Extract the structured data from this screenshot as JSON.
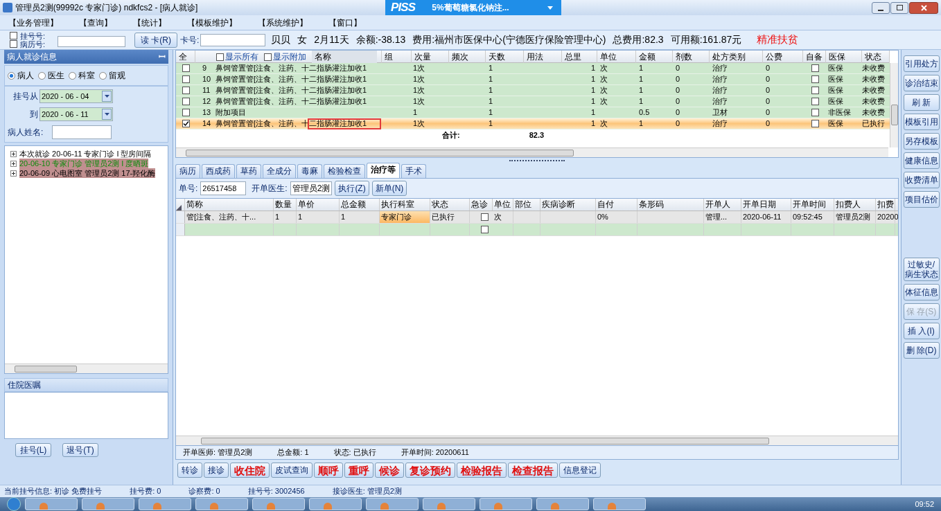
{
  "window": {
    "title": "管理员2测(99992c 专家门诊) ndkfcs2 - [病人就诊]",
    "logo": "PISS",
    "drug_dropdown": "5%葡萄糖氯化钠注..."
  },
  "menu": [
    "【业务管理】",
    "【查询】",
    "【统计】",
    "【模板维护】",
    "【系统维护】",
    "【窗口】"
  ],
  "patient_bar": {
    "id_options": [
      {
        "label": "挂号号:",
        "checked": false
      },
      {
        "label": "病历号:",
        "checked": false
      }
    ],
    "read_card": "读 卡(R)",
    "card_label": "卡号:",
    "info": [
      "贝贝",
      "女",
      "2月11天",
      "余额:-38.13",
      "费用:福州市医保中心(宁德医疗保险管理中心)",
      "总费用:82.3",
      "可用额:161.87元"
    ],
    "tag": "精准扶贫"
  },
  "left_panel": {
    "title": "病人就诊信息",
    "pin": "ꟷ",
    "radios": [
      {
        "label": "病人",
        "selected": true
      },
      {
        "label": "医生",
        "selected": false
      },
      {
        "label": "科室",
        "selected": false
      },
      {
        "label": "留观",
        "selected": false
      }
    ],
    "from_label": "挂号从",
    "from_date": "2020 - 06 - 04",
    "to_label": "到",
    "to_date": "2020 - 06 - 11",
    "name_label": "病人姓名:",
    "visits": [
      {
        "text": "本次就诊 20-06-11 专家门诊 I 型房间隔",
        "kind": "current"
      },
      {
        "text": "20-06-10 专家门诊 管理员2测 I 度晒斑",
        "kind": "flagged"
      },
      {
        "text": "20-06-09 心电图室 管理员2测 17-羟化酶",
        "kind": "past"
      }
    ],
    "orders_title": "住院医嘱",
    "buttons": [
      "挂号(L)",
      "退号(T)"
    ]
  },
  "prescription": {
    "toggles": [
      {
        "label": "显示所有",
        "checked": false
      },
      {
        "label": "显示附加",
        "checked": false
      }
    ],
    "columns": [
      "全",
      "名称",
      "组",
      "次量",
      "频次",
      "天数",
      "用法",
      "总里",
      "单位",
      "金额",
      "剂数",
      "处方类别",
      "公费",
      "自备",
      "医保",
      "状态"
    ],
    "rows": [
      {
        "checked": false,
        "no": "9",
        "name": "鼻饲管置管[注食、注药、十二指肠灌注加收1",
        "dose": "1次",
        "days": "1",
        "total": "1",
        "unit": "次",
        "amount": "1",
        "count": "0",
        "category": "治疗",
        "public": "0",
        "own": false,
        "insurance": "医保",
        "status": "未收费",
        "selected": false,
        "marked": false
      },
      {
        "checked": false,
        "no": "10",
        "name": "鼻饲管置管[注食、注药、十二指肠灌注加收1",
        "dose": "1次",
        "days": "1",
        "total": "1",
        "unit": "次",
        "amount": "1",
        "count": "0",
        "category": "治疗",
        "public": "0",
        "own": false,
        "insurance": "医保",
        "status": "未收费",
        "selected": false,
        "marked": false
      },
      {
        "checked": false,
        "no": "11",
        "name": "鼻饲管置管[注食、注药、十二指肠灌注加收1",
        "dose": "1次",
        "days": "1",
        "total": "1",
        "unit": "次",
        "amount": "1",
        "count": "0",
        "category": "治疗",
        "public": "0",
        "own": false,
        "insurance": "医保",
        "status": "未收费",
        "selected": false,
        "marked": false
      },
      {
        "checked": false,
        "no": "12",
        "name": "鼻饲管置管[注食、注药、十二指肠灌注加收1",
        "dose": "1次",
        "days": "1",
        "total": "1",
        "unit": "次",
        "amount": "1",
        "count": "0",
        "category": "治疗",
        "public": "0",
        "own": false,
        "insurance": "医保",
        "status": "未收费",
        "selected": false,
        "marked": false
      },
      {
        "checked": false,
        "no": "13",
        "name": "附加项目",
        "dose": "1",
        "days": "1",
        "total": "1",
        "unit": "",
        "amount": "0.5",
        "count": "0",
        "category": "卫材",
        "public": "0",
        "own": false,
        "insurance": "非医保",
        "status": "未收费",
        "selected": false,
        "marked": false
      },
      {
        "checked": true,
        "no": "14",
        "name": "鼻饲管置管[注食、注药、十二指肠灌注加收1",
        "dose": "1次",
        "days": "1",
        "total": "1",
        "unit": "次",
        "amount": "1",
        "count": "0",
        "category": "治疗",
        "public": "0",
        "own": false,
        "insurance": "医保",
        "status": "已执行",
        "selected": true,
        "marked": true
      }
    ],
    "total_label": "合计:",
    "total_value": "82.3"
  },
  "tabs": [
    {
      "label": "病历",
      "selected": false
    },
    {
      "label": "西成药",
      "selected": false
    },
    {
      "label": "草药",
      "selected": false
    },
    {
      "label": "全成分",
      "selected": false
    },
    {
      "label": "毒麻",
      "selected": false
    },
    {
      "label": "检验检查",
      "selected": false
    },
    {
      "label": "治疗等",
      "selected": true
    },
    {
      "label": "手术",
      "selected": false
    }
  ],
  "order_form": {
    "no_label": "单号:",
    "no": "26517458",
    "doctor_label": "开单医生:",
    "doctor": "管理员2测",
    "buttons": [
      "执行(Z)",
      "新单(N)"
    ]
  },
  "order_table": {
    "columns": [
      "简称",
      "数量",
      "单价",
      "总金额",
      "执行科室",
      "状态",
      "急诊",
      "单位",
      "部位",
      "疾病诊断",
      "自付",
      "条形码",
      "开单人",
      "开单日期",
      "开单时间",
      "扣费人",
      "扣费"
    ],
    "rows": [
      {
        "cells": [
          "管[注食、注药、十...",
          "1",
          "1",
          "1",
          "专家门诊",
          "已执行",
          "",
          "次",
          "",
          "",
          "0%",
          "",
          "管理...",
          "2020-06-11",
          "09:52:45",
          "管理员2测",
          "20200"
        ],
        "urgent": false,
        "blank": false
      },
      {
        "cells": [
          "",
          "",
          "",
          "",
          "",
          "",
          "",
          "",
          "",
          "",
          "",
          "",
          "",
          "",
          "",
          "",
          ""
        ],
        "urgent": false,
        "blank": true
      }
    ]
  },
  "summary": [
    {
      "label": "开单医师:",
      "value": "管理员2测"
    },
    {
      "label": "总金额:",
      "value": "1"
    },
    {
      "label": "状态:",
      "value": "已执行"
    },
    {
      "label": "开单时间:",
      "value": "20200611"
    }
  ],
  "actions": [
    {
      "label": "转诊",
      "kind": "normal"
    },
    {
      "label": "接诊",
      "kind": "normal"
    },
    {
      "label": "收住院",
      "kind": "alert"
    },
    {
      "label": "皮试查询",
      "kind": "normal"
    },
    {
      "label": "顺呼",
      "kind": "alert"
    },
    {
      "label": "重呼",
      "kind": "alert"
    },
    {
      "label": "候诊",
      "kind": "alert"
    },
    {
      "label": "复诊预约",
      "kind": "alert"
    },
    {
      "label": "检验报告",
      "kind": "alert"
    },
    {
      "label": "检查报告",
      "kind": "alert"
    },
    {
      "label": "信息登记",
      "kind": "normal"
    }
  ],
  "side_buttons_top": [
    {
      "label": "引用处方",
      "disabled": false
    },
    {
      "label": "诊治结束",
      "disabled": false
    },
    {
      "label": "刷 新",
      "disabled": false
    },
    {
      "label": "模板引用",
      "disabled": false
    },
    {
      "label": "另存模板",
      "disabled": false
    },
    {
      "label": "健康信息",
      "disabled": false
    },
    {
      "label": "收费清单",
      "disabled": false
    },
    {
      "label": "项目估价",
      "disabled": false
    }
  ],
  "side_buttons_bottom": [
    {
      "label": "过敏史/病生状态",
      "disabled": false
    },
    {
      "label": "体征信息",
      "disabled": false
    },
    {
      "label": "保 存(S)",
      "disabled": true
    },
    {
      "label": "插 入(I)",
      "disabled": false
    },
    {
      "label": "删 除(D)",
      "disabled": false
    }
  ],
  "status_bar": [
    {
      "label": "当前挂号信息:",
      "value": "初诊 免费挂号"
    },
    {
      "label": "挂号费:",
      "value": "0"
    },
    {
      "label": "诊察费:",
      "value": "0"
    },
    {
      "label": "挂号号:",
      "value": "3002456"
    },
    {
      "label": "接诊医生:",
      "value": "管理员2测"
    }
  ],
  "taskbar": {
    "clock": "09:52"
  }
}
